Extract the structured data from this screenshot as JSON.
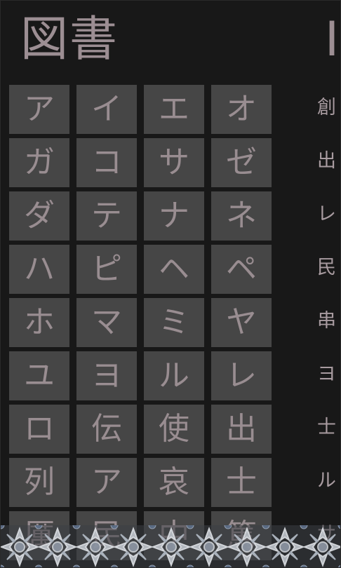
{
  "header": {
    "title": "図書",
    "next_section_title": "IF"
  },
  "index_tiles": [
    "ア",
    "イ",
    "エ",
    "オ",
    "ガ",
    "コ",
    "サ",
    "ゼ",
    "ダ",
    "テ",
    "ナ",
    "ネ",
    "ハ",
    "ピ",
    "ヘ",
    "ペ",
    "ホ",
    "マ",
    "ミ",
    "ヤ",
    "ユ",
    "ヨ",
    "ル",
    "レ",
    "ロ",
    "伝",
    "使",
    "出",
    "列",
    "ア",
    "哀",
    "士",
    "厲",
    "民",
    "中",
    "篤"
  ],
  "side_list": [
    "創",
    "出",
    "レ",
    "民",
    "串",
    "ヨ",
    "士",
    "ル",
    "サ"
  ],
  "colors": {
    "background": "#181818",
    "tile": "#464646",
    "text": "#a89ba0"
  }
}
